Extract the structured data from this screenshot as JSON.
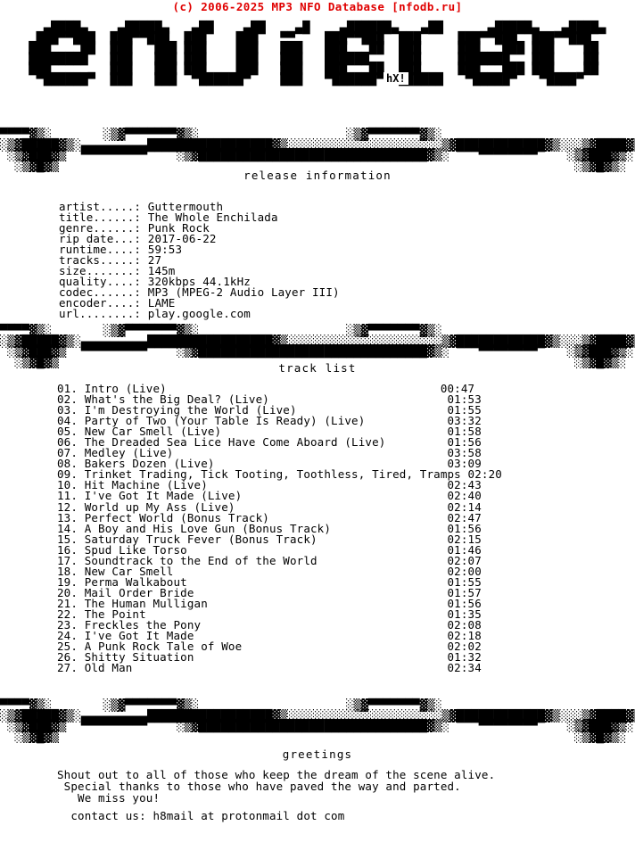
{
  "header": {
    "copyright": "(c) 2006-2025 MP3 NFO Database [nfodb.ru]",
    "copyright_color": "#e00000"
  },
  "logo": {
    "group_name": "entitled",
    "artist_tag": "hX!",
    "ascii_art": "   ▄████▄    ▄█████▄   ▄██    ▄██    ▄█    ▄██████▄   ▄██      ▄█████▄   ▄████▄\n  ███▀▀███  ███▀▀███  ███    ███   ▀▀    ███▀▀███  ███     ███▀▀███  ███▀▀███\n ███    ██  ███   ███ ███    ███   ███   ███   ██  ███     ███   ███ ███    ██\n ████████   ███   ███ ███    ███   ███   ██████    ███     ███████   ███    ██\n ███        ███   ███ ███    ███   ███   ███   ██  ███     ███   ███ ███    ██\n  ▀██████▀  ███   ███  ▀██████▀    ███   ▀██████▀  ██████   ▀█████▀   ▀████▀"
  },
  "dividers": {
    "bar": "▀▀▀▀▓▒░       ░▒▓▀▀▀▀▀▀▀▓▒░                    ░▒▓▀▀▀▀▀▀▀▓▒░\n░▒▓█████▓▒░▄▄▄▄▄▄▄▄▄█████████████████▓▒░░░░░░░░░░░░░░░░░░░░░▒▓████████████▓▒░░░▒▓████▓▒\n ░▒▓███▓▒  ▀▀▀▀▀▀▀▀▀    ░▒▓███████████████████████████████▓▒░    ▀▀▀▀▀▀▀▀    ░▒▓███▓▒░\n  ░▒▓█▓▒                                                                      ░▒▓█▓▒░"
  },
  "sections": {
    "release_heading": "release information",
    "tracklist_heading": "track list",
    "greetings_heading": "greetings"
  },
  "release_info": {
    "fields": [
      {
        "label": "artist.....:",
        "value": "Guttermouth"
      },
      {
        "label": "title......:",
        "value": "The Whole Enchilada"
      },
      {
        "label": "genre......:",
        "value": "Punk Rock"
      },
      {
        "label": "rip date...:",
        "value": "2017-06-22"
      },
      {
        "label": "runtime....:",
        "value": "59:53"
      },
      {
        "label": "tracks.....:",
        "value": "27"
      },
      {
        "label": "size.......:",
        "value": "145m"
      },
      {
        "label": "quality....:",
        "value": "320kbps 44.1kHz"
      },
      {
        "label": "codec......:",
        "value": "MP3 (MPEG-2 Audio Layer III)"
      },
      {
        "label": "encoder....:",
        "value": "LAME"
      },
      {
        "label": "url........:",
        "value": "play.google.com"
      }
    ],
    "text": "artist.....: Guttermouth\ntitle......: The Whole Enchilada\ngenre......: Punk Rock\nrip date...: 2017-06-22\nruntime....: 59:53\ntracks.....: 27\nsize.......: 145m\nquality....: 320kbps 44.1kHz\ncodec......: MP3 (MPEG-2 Audio Layer III)\nencoder....: LAME\nurl........: play.google.com"
  },
  "tracklist": {
    "tracks": [
      {
        "num": "01.",
        "title": "Intro (Live)",
        "time": "00:47"
      },
      {
        "num": "02.",
        "title": "What's the Big Deal? (Live)",
        "time": "01:53"
      },
      {
        "num": "03.",
        "title": "I'm Destroying the World (Live)",
        "time": "01:55"
      },
      {
        "num": "04.",
        "title": "Party of Two (Your Table Is Ready) (Live)",
        "time": "03:32"
      },
      {
        "num": "05.",
        "title": "New Car Smell (Live)",
        "time": "01:58"
      },
      {
        "num": "06.",
        "title": "The Dreaded Sea Lice Have Come Aboard (Live)",
        "time": "01:56"
      },
      {
        "num": "07.",
        "title": "Medley (Live)",
        "time": "03:58"
      },
      {
        "num": "08.",
        "title": "Bakers Dozen (Live)",
        "time": "03:09"
      },
      {
        "num": "09.",
        "title": "Trinket Trading, Tick Tooting, Toothless, Tired, Tramps",
        "time": "02:20"
      },
      {
        "num": "10.",
        "title": "Hit Machine (Live)",
        "time": "02:43"
      },
      {
        "num": "11.",
        "title": "I've Got It Made (Live)",
        "time": "02:40"
      },
      {
        "num": "12.",
        "title": "World up My Ass (Live)",
        "time": "02:14"
      },
      {
        "num": "13.",
        "title": "Perfect World (Bonus Track)",
        "time": "02:47"
      },
      {
        "num": "14.",
        "title": "A Boy and His Love Gun (Bonus Track)",
        "time": "01:56"
      },
      {
        "num": "15.",
        "title": "Saturday Truck Fever (Bonus Track)",
        "time": "02:15"
      },
      {
        "num": "16.",
        "title": "Spud Like Torso",
        "time": "01:46"
      },
      {
        "num": "17.",
        "title": "Soundtrack to the End of the World",
        "time": "02:07"
      },
      {
        "num": "18.",
        "title": "New Car Smell",
        "time": "02:00"
      },
      {
        "num": "19.",
        "title": "Perma Walkabout",
        "time": "01:55"
      },
      {
        "num": "20.",
        "title": "Mail Order Bride",
        "time": "01:57"
      },
      {
        "num": "21.",
        "title": "The Human Mulligan",
        "time": "01:56"
      },
      {
        "num": "22.",
        "title": "The Point",
        "time": "01:35"
      },
      {
        "num": "23.",
        "title": "Freckles the Pony",
        "time": "02:08"
      },
      {
        "num": "24.",
        "title": "I've Got It Made",
        "time": "02:18"
      },
      {
        "num": "25.",
        "title": "A Punk Rock Tale of Woe",
        "time": "02:02"
      },
      {
        "num": "26.",
        "title": "Shitty Situation",
        "time": "01:32"
      },
      {
        "num": "27.",
        "title": "Old Man",
        "time": "02:34"
      }
    ],
    "text": "01. Intro (Live)                                        00:47\n02. What's the Big Deal? (Live)                          01:53\n03. I'm Destroying the World (Live)                      01:55\n04. Party of Two (Your Table Is Ready) (Live)            03:32\n05. New Car Smell (Live)                                 01:58\n06. The Dreaded Sea Lice Have Come Aboard (Live)         01:56\n07. Medley (Live)                                        03:58\n08. Bakers Dozen (Live)                                  03:09\n09. Trinket Trading, Tick Tooting, Toothless, Tired, Tramps 02:20\n10. Hit Machine (Live)                                   02:43\n11. I've Got It Made (Live)                              02:40\n12. World up My Ass (Live)                               02:14\n13. Perfect World (Bonus Track)                          02:47\n14. A Boy and His Love Gun (Bonus Track)                 01:56\n15. Saturday Truck Fever (Bonus Track)                   02:15\n16. Spud Like Torso                                      01:46\n17. Soundtrack to the End of the World                   02:07\n18. New Car Smell                                        02:00\n19. Perma Walkabout                                      01:55\n20. Mail Order Bride                                     01:57\n21. The Human Mulligan                                   01:56\n22. The Point                                            01:35\n23. Freckles the Pony                                    02:08\n24. I've Got It Made                                     02:18\n25. A Punk Rock Tale of Woe                              02:02\n26. Shitty Situation                                     01:32\n27. Old Man                                              02:34"
  },
  "greetings": {
    "lines": [
      "Shout out to all of those who keep the dream of the scene alive.",
      " Special thanks to those who have paved the way and parted.",
      "   We miss you!"
    ],
    "text": "Shout out to all of those who keep the dream of the scene alive.\n Special thanks to those who have paved the way and parted.\n   We miss you!",
    "contact": "  contact us: h8mail at protonmail dot com"
  }
}
